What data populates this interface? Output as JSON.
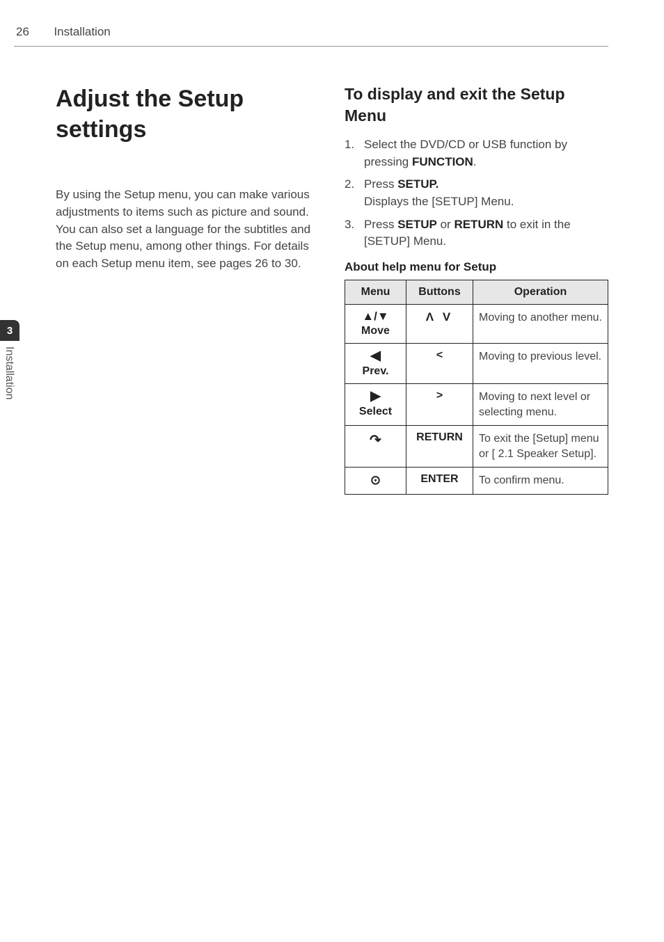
{
  "header": {
    "page_number": "26",
    "section": "Installation"
  },
  "side_tab": {
    "chapter_number": "3",
    "chapter_label": "Installation"
  },
  "left": {
    "heading": "Adjust the Setup settings",
    "paragraph": "By using the Setup menu, you can make various adjustments to items such as picture and sound.\nYou can also set a language for the subtitles and the Setup menu, among other things. For details on each Setup menu item, see pages 26 to 30."
  },
  "right": {
    "heading": "To display and exit the Setup Menu",
    "steps": [
      {
        "pre": "Select the DVD/CD or USB function by pressing ",
        "bold": "FUNCTION",
        "post": "."
      },
      {
        "pre": "Press ",
        "bold": "SETUP.",
        "post": "",
        "line2": "Displays the [SETUP] Menu."
      },
      {
        "pre": "Press ",
        "bold": "SETUP",
        "mid": " or ",
        "bold2": "RETURN",
        "post": " to exit in the [SETUP] Menu."
      }
    ],
    "table_caption": "About help menu for Setup",
    "table": {
      "headers": [
        "Menu",
        "Buttons",
        "Operation"
      ],
      "rows": [
        {
          "menu_glyph": "▲/▼",
          "menu_label": "Move",
          "buttons": "Λ V",
          "operation": "Moving to another menu."
        },
        {
          "menu_glyph": "◀",
          "menu_label": "Prev.",
          "buttons": "<",
          "operation": "Moving to previous level."
        },
        {
          "menu_glyph": "▶",
          "menu_label": "Select",
          "buttons": ">",
          "operation": "Moving to next level or selecting menu."
        },
        {
          "menu_glyph": "↶",
          "menu_label": "",
          "buttons": "RETURN",
          "operation": "To exit the [Setup] menu or [ 2.1 Speaker Setup]."
        },
        {
          "menu_glyph": "⊙",
          "menu_label": "",
          "buttons": "ENTER",
          "operation": "To confirm menu."
        }
      ]
    }
  }
}
